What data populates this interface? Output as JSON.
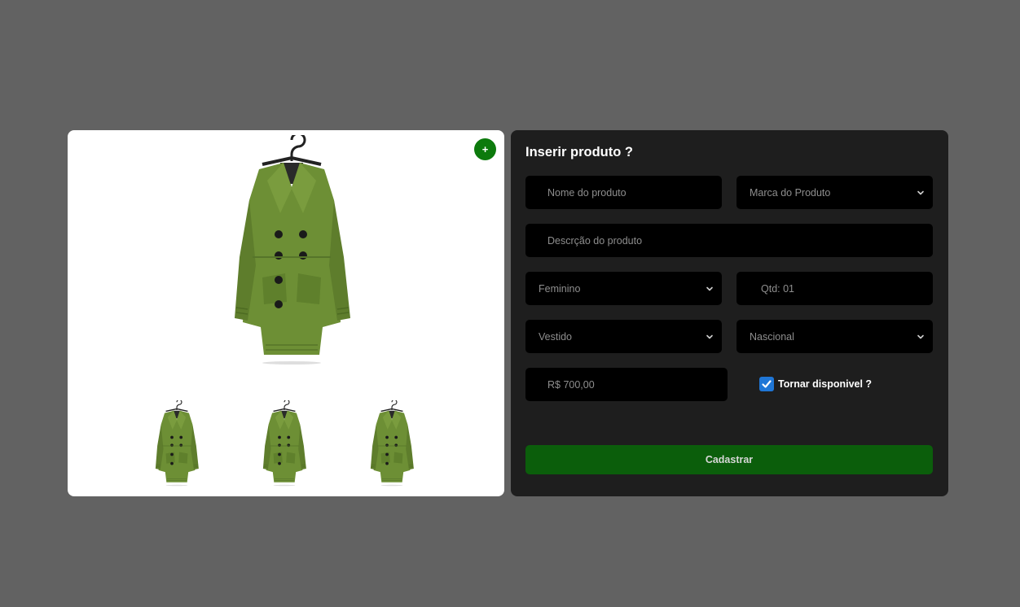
{
  "gallery": {
    "add_button_label": "+",
    "coat_color": "#6d8f35",
    "thumbnail_count": 3
  },
  "form": {
    "title": "Inserir produto ?",
    "product_name_placeholder": "Nome do produto",
    "brand_select_value": "Marca do Produto",
    "description_placeholder": "Descrção do produto",
    "gender_select_value": "Feminino",
    "quantity_value": "Qtd: 01",
    "category_select_value": "Vestido",
    "origin_select_value": "Nascional",
    "price_value": "R$ 700,00",
    "available_checkbox_label": "Tornar disponivel ?",
    "available_checked": true,
    "submit_label": "Cadastrar"
  },
  "colors": {
    "background": "#626262",
    "form_panel": "#1e1e1e",
    "field": "#000000",
    "submit": "#0b5e0b",
    "add_button": "#0c7a0c",
    "checkbox": "#1f76d6"
  }
}
